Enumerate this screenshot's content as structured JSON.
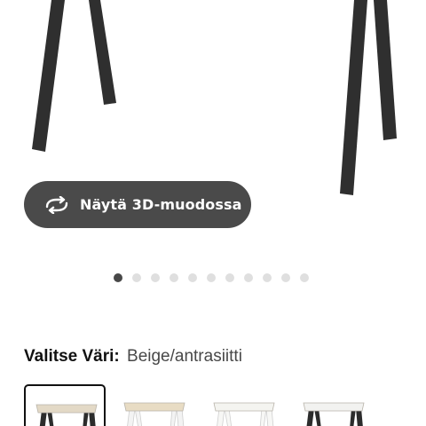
{
  "product": {
    "view_3d_label": "Näytä 3D-muodossa",
    "gallery_total": 11,
    "gallery_active": 1
  },
  "color_selector": {
    "label": "Valitse Väri:",
    "selected_value": "Beige/antrasiitti",
    "swatches": [
      {
        "top_color": "#e3d9c6",
        "leg_color": "#2c2c2c",
        "selected": true
      },
      {
        "top_color": "#e8dcc4",
        "leg_color": "#f3f3f3",
        "selected": false
      },
      {
        "top_color": "#f4f4f0",
        "leg_color": "#f7f7f5",
        "selected": false
      },
      {
        "top_color": "#f2f2f0",
        "leg_color": "#2c2c2c",
        "selected": false
      }
    ]
  },
  "colors": {
    "button_bg": "#4a4a4a",
    "leg_color": "#2f2f2f",
    "dot_active": "#484848",
    "dot_inactive": "#dfdfdf"
  }
}
